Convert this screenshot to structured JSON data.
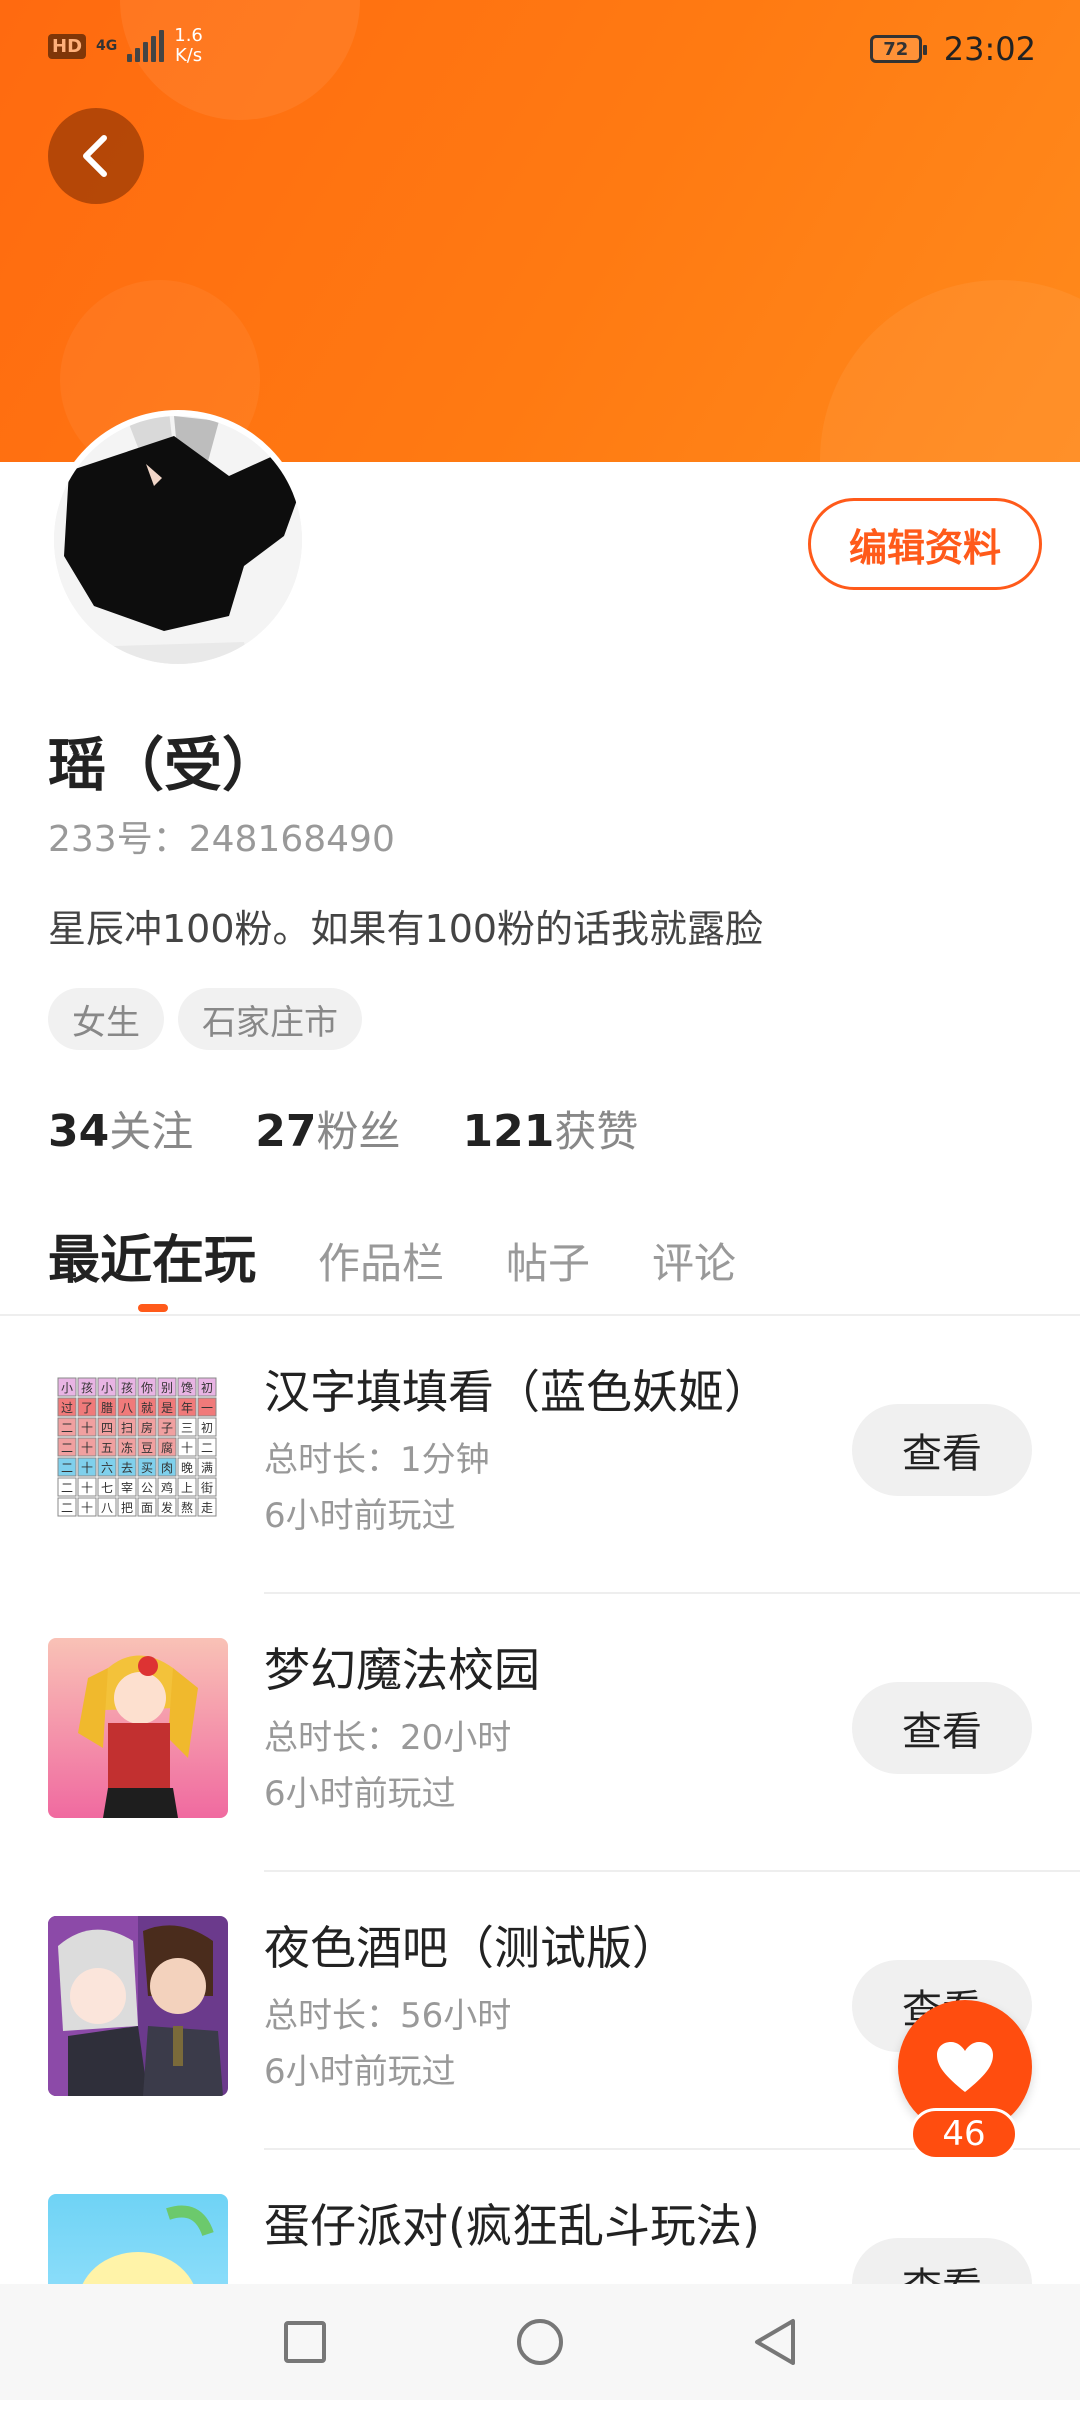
{
  "status_bar": {
    "hd": "HD",
    "network": "4G",
    "speed_value": "1.6",
    "speed_unit": "K/s",
    "battery": "72",
    "time": "23:02"
  },
  "header": {
    "back_icon": "chevron-left-icon"
  },
  "profile": {
    "edit_label": "编辑资料",
    "name": "瑶（受）",
    "id_text": "233号：248168490",
    "bio": "星辰冲100粉。如果有100粉的话我就露脸",
    "tags": [
      "女生",
      "石家庄市"
    ],
    "stats": [
      {
        "num": "34",
        "label": "关注"
      },
      {
        "num": "27",
        "label": "粉丝"
      },
      {
        "num": "121",
        "label": "获赞"
      }
    ]
  },
  "tabs": [
    "最近在玩",
    "作品栏",
    "帖子",
    "评论"
  ],
  "games": [
    {
      "title": "汉字填填看（蓝色妖姬）",
      "duration": "总时长：1分钟",
      "last": "6小时前玩过",
      "button": "查看"
    },
    {
      "title": "梦幻魔法校园",
      "duration": "总时长：20小时",
      "last": "6小时前玩过",
      "button": "查看"
    },
    {
      "title": "夜色酒吧（测试版）",
      "duration": "总时长：56小时",
      "last": "6小时前玩过",
      "button": "查看"
    },
    {
      "title": "蛋仔派对(疯狂乱斗玩法)",
      "duration": "",
      "last": "",
      "button": "查看"
    }
  ],
  "thumb_chars": [
    [
      "小",
      "孩",
      "小",
      "孩",
      "你",
      "别",
      "馋",
      "初"
    ],
    [
      "过",
      "了",
      "腊",
      "八",
      "就",
      "是",
      "年",
      "一"
    ],
    [
      "二",
      "十",
      "四",
      "扫",
      "房",
      "子",
      "三",
      "初"
    ],
    [
      "二",
      "十",
      "五",
      "冻",
      "豆",
      "腐",
      "十",
      "二"
    ],
    [
      "二",
      "十",
      "六",
      "去",
      "买",
      "肉",
      "晚",
      "满"
    ],
    [
      "二",
      "十",
      "七",
      "宰",
      "公",
      "鸡",
      "上",
      "街"
    ],
    [
      "二",
      "十",
      "八",
      "把",
      "面",
      "发",
      "熬",
      "走"
    ]
  ],
  "fab": {
    "icon": "heart-icon",
    "count": "46"
  },
  "colors": {
    "accent": "#ff5a1a",
    "header": "#ff7a12"
  }
}
